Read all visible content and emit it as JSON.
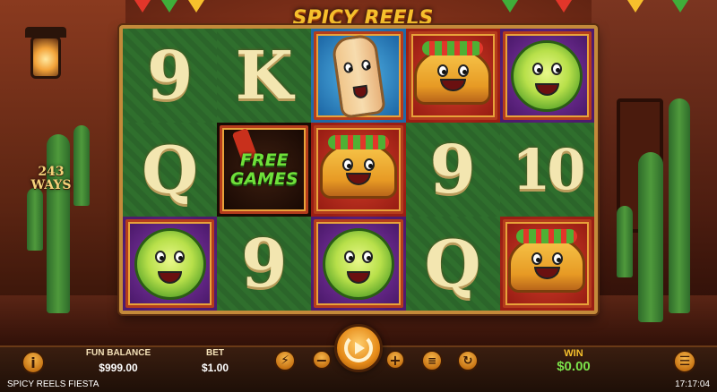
{
  "game": {
    "title": "SPICY REELS FIESTA",
    "logo_text": "SPICY REELS FIESTA",
    "ways_number": "243",
    "ways_label": "WAYS"
  },
  "reels": [
    [
      {
        "symbol": "9",
        "kind": "text"
      },
      {
        "symbol": "K",
        "kind": "text"
      },
      {
        "symbol": "burrito",
        "kind": "food",
        "bg": "blue"
      },
      {
        "symbol": "taco",
        "kind": "food",
        "bg": "red"
      },
      {
        "symbol": "lime",
        "kind": "food",
        "bg": "purple"
      }
    ],
    [
      {
        "symbol": "Q",
        "kind": "text"
      },
      {
        "symbol": "FREE GAMES",
        "kind": "scatter",
        "bg": "dark"
      },
      {
        "symbol": "taco",
        "kind": "food",
        "bg": "red"
      },
      {
        "symbol": "9",
        "kind": "text"
      },
      {
        "symbol": "10",
        "kind": "text"
      }
    ],
    [
      {
        "symbol": "lime",
        "kind": "food",
        "bg": "purple"
      },
      {
        "symbol": "9",
        "kind": "text"
      },
      {
        "symbol": "lime",
        "kind": "food",
        "bg": "purple"
      },
      {
        "symbol": "Q",
        "kind": "text"
      },
      {
        "symbol": "taco",
        "kind": "food",
        "bg": "red"
      }
    ]
  ],
  "scatter": {
    "line1": "FREE",
    "line2": "GAMES"
  },
  "controls": {
    "info_icon": "info-icon",
    "balance_label": "FUN BALANCE",
    "balance_value": "$999.00",
    "bet_label": "BET",
    "bet_value": "$1.00",
    "turbo_icon": "lightning-icon",
    "bet_decrease": "−",
    "bet_increase": "+",
    "spin_icon": "spin-icon",
    "coins_icon": "coins-icon",
    "autoplay_icon": "autoplay-icon",
    "win_label": "WIN",
    "win_value": "$0.00",
    "menu_icon": "hamburger-menu-icon"
  },
  "footer": {
    "title": "SPICY REELS FIESTA",
    "clock": "17:17:04"
  },
  "colors": {
    "accent": "#f6c02c",
    "win_green": "#7ae04a",
    "reel_green": "#2c6a2b",
    "frame": "#c48a3a"
  }
}
